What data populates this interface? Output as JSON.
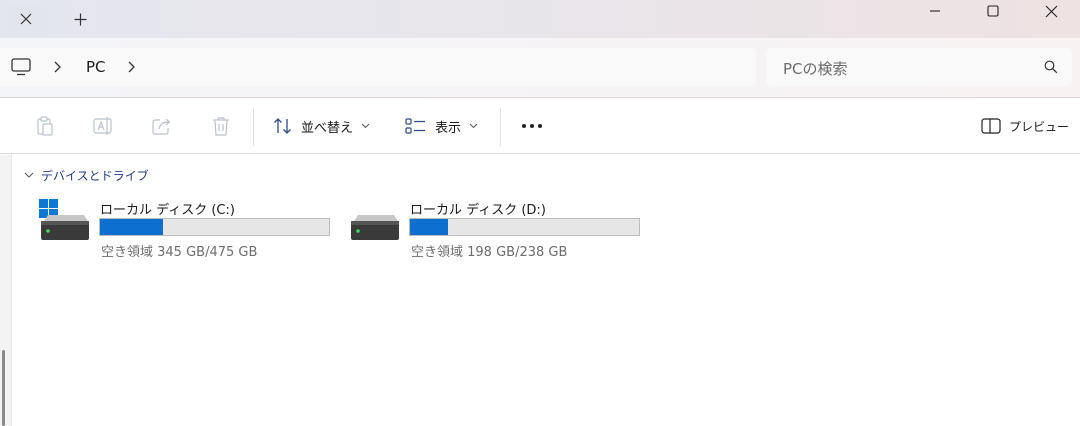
{
  "titlebar": {
    "close_tab_icon": "close-icon",
    "new_tab_icon": "plus-icon"
  },
  "address": {
    "location_icon": "monitor-icon",
    "breadcrumb": [
      "PC"
    ]
  },
  "search": {
    "placeholder": "PCの検索",
    "icon": "search-icon"
  },
  "toolbar": {
    "sort_label": "並べ替え",
    "view_label": "表示",
    "preview_label": "プレビュー"
  },
  "group": {
    "label": "デバイスとドライブ"
  },
  "drives": [
    {
      "name": "ローカル ディスク (C:)",
      "space": "空き領域 345 GB/475 GB",
      "used_fraction": 0.274,
      "has_windows_logo": true
    },
    {
      "name": "ローカル ディスク (D:)",
      "space": "空き領域 198 GB/238 GB",
      "used_fraction": 0.168,
      "has_windows_logo": false
    }
  ],
  "colors": {
    "usage_bar": "#0d6fd0",
    "group_label": "#1f3c88",
    "windows_logo": "#0a78d4"
  }
}
